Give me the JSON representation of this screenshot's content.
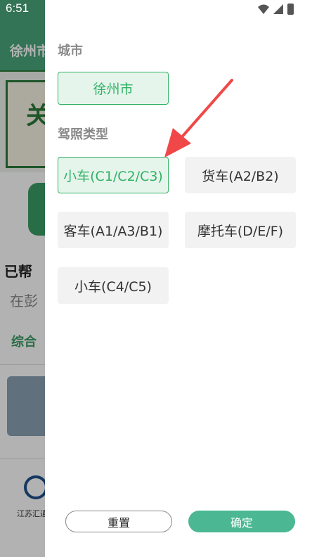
{
  "status_bar": {
    "time": "6:51"
  },
  "background": {
    "city": "徐州市",
    "banner_char": "关",
    "helped_text": "已帮",
    "in_text": "在彭",
    "tab_label": "综合",
    "logo_text": "江苏汇通"
  },
  "filter": {
    "city_section_title": "城市",
    "city_selected": "徐州市",
    "license_section_title": "驾照类型",
    "license_options": [
      {
        "label": "小车(C1/C2/C3)",
        "selected": true
      },
      {
        "label": "货车(A2/B2)",
        "selected": false
      },
      {
        "label": "客车(A1/A3/B1)",
        "selected": false
      },
      {
        "label": "摩托车(D/E/F)",
        "selected": false
      },
      {
        "label": "小车(C4/C5)",
        "selected": false
      }
    ],
    "reset_label": "重置",
    "confirm_label": "确定"
  },
  "colors": {
    "accent_green": "#2fb264",
    "confirm_button": "#4bb893",
    "arrow": "#f04848"
  }
}
